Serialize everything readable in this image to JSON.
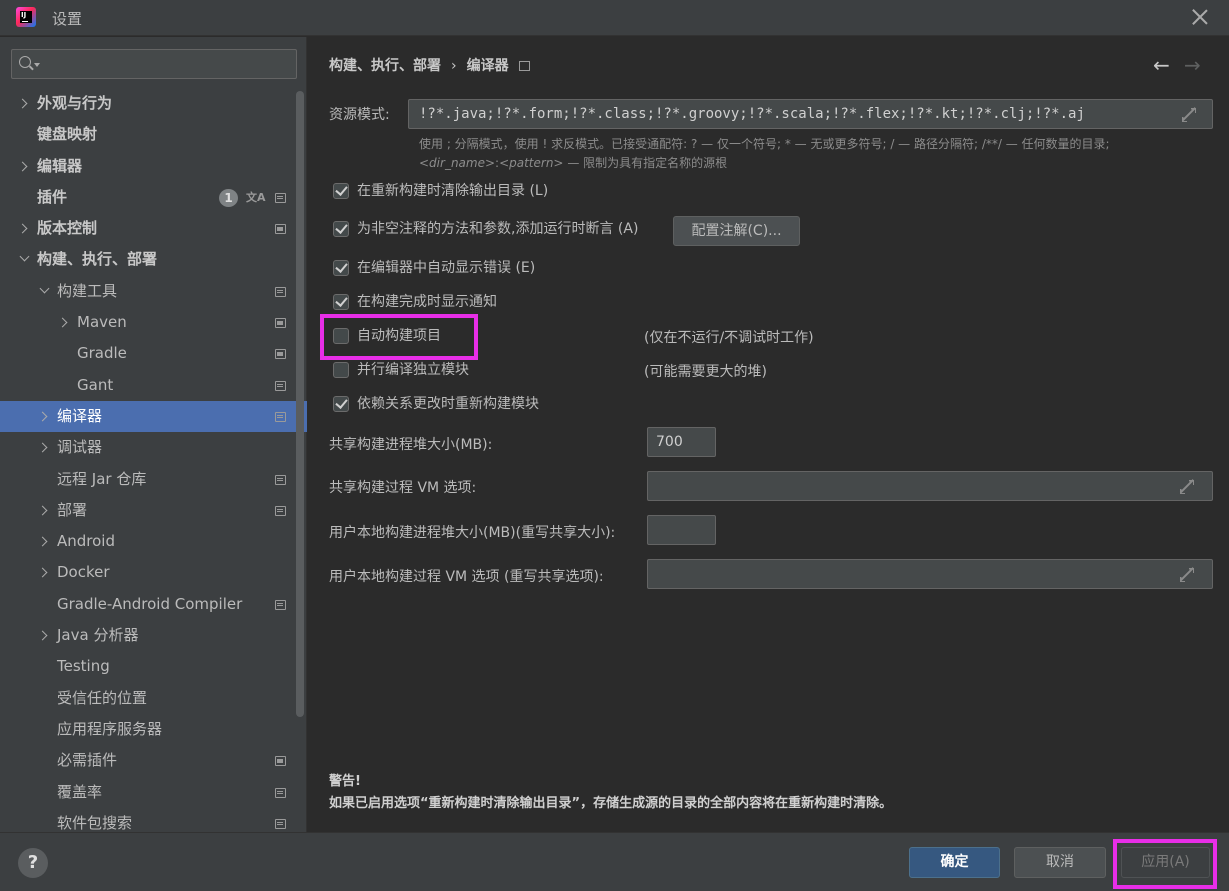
{
  "window": {
    "title": "设置"
  },
  "sidebar": {
    "search_placeholder": "",
    "items": [
      {
        "label": "外观与行为",
        "level": 0,
        "expander": "collapsed",
        "bold": true,
        "icons": []
      },
      {
        "label": "键盘映射",
        "level": 0,
        "expander": "none",
        "bold": true,
        "icons": []
      },
      {
        "label": "编辑器",
        "level": 0,
        "expander": "collapsed",
        "bold": true,
        "icons": []
      },
      {
        "label": "插件",
        "level": 0,
        "expander": "none",
        "bold": true,
        "icons": [
          "badge",
          "translate",
          "project"
        ],
        "badge": "1"
      },
      {
        "label": "版本控制",
        "level": 0,
        "expander": "collapsed",
        "bold": true,
        "icons": [
          "project"
        ]
      },
      {
        "label": "构建、执行、部署",
        "level": 0,
        "expander": "expanded",
        "bold": true,
        "icons": []
      },
      {
        "label": "构建工具",
        "level": 1,
        "expander": "expanded",
        "bold": false,
        "icons": [
          "project"
        ]
      },
      {
        "label": "Maven",
        "level": 2,
        "expander": "collapsed",
        "bold": false,
        "icons": [
          "project"
        ]
      },
      {
        "label": "Gradle",
        "level": 2,
        "expander": "none",
        "bold": false,
        "icons": [
          "project"
        ]
      },
      {
        "label": "Gant",
        "level": 2,
        "expander": "none",
        "bold": false,
        "icons": [
          "project"
        ]
      },
      {
        "label": "编译器",
        "level": 1,
        "expander": "collapsed",
        "bold": false,
        "icons": [
          "project"
        ],
        "selected": true
      },
      {
        "label": "调试器",
        "level": 1,
        "expander": "collapsed",
        "bold": false,
        "icons": []
      },
      {
        "label": "远程 Jar 仓库",
        "level": 1,
        "expander": "none",
        "bold": false,
        "icons": [
          "project"
        ]
      },
      {
        "label": "部署",
        "level": 1,
        "expander": "collapsed",
        "bold": false,
        "icons": [
          "project"
        ]
      },
      {
        "label": "Android",
        "level": 1,
        "expander": "collapsed",
        "bold": false,
        "icons": []
      },
      {
        "label": "Docker",
        "level": 1,
        "expander": "collapsed",
        "bold": false,
        "icons": []
      },
      {
        "label": "Gradle-Android Compiler",
        "level": 1,
        "expander": "none",
        "bold": false,
        "icons": [
          "project"
        ]
      },
      {
        "label": "Java 分析器",
        "level": 1,
        "expander": "collapsed",
        "bold": false,
        "icons": []
      },
      {
        "label": "Testing",
        "level": 1,
        "expander": "none",
        "bold": false,
        "icons": []
      },
      {
        "label": "受信任的位置",
        "level": 1,
        "expander": "none",
        "bold": false,
        "icons": []
      },
      {
        "label": "应用程序服务器",
        "level": 1,
        "expander": "none",
        "bold": false,
        "icons": []
      },
      {
        "label": "必需插件",
        "level": 1,
        "expander": "none",
        "bold": false,
        "icons": [
          "project"
        ]
      },
      {
        "label": "覆盖率",
        "level": 1,
        "expander": "none",
        "bold": false,
        "icons": [
          "project"
        ]
      },
      {
        "label": "软件包搜索",
        "level": 1,
        "expander": "none",
        "bold": false,
        "icons": [
          "project"
        ]
      }
    ]
  },
  "main": {
    "breadcrumb": [
      "构建、执行、部署",
      "编译器"
    ],
    "resource_patterns": {
      "label": "资源模式:",
      "value": "!?*.java;!?*.form;!?*.class;!?*.groovy;!?*.scala;!?*.flex;!?*.kt;!?*.clj;!?*.aj",
      "hint_line1": "使用 ; 分隔模式，使用 ! 求反模式。已接受通配符: ? — 仅一个符号; * — 无或更多符号; / — 路径分隔符; /**/ — 任何数量的目录;",
      "hint_line2_em1": "<dir_name>",
      "hint_line2_sep": ":",
      "hint_line2_em2": "<pattern>",
      "hint_line2_rest": " — 限制为具有指定名称的源根"
    },
    "checkboxes": [
      {
        "label": "在重新构建时清除输出目录 (L)",
        "checked": true
      },
      {
        "label": "为非空注释的方法和参数,添加运行时断言 (A)",
        "checked": true
      },
      {
        "label": "在编辑器中自动显示错误 (E)",
        "checked": true
      },
      {
        "label": "在构建完成时显示通知",
        "checked": true
      },
      {
        "label": "自动构建项目",
        "checked": false
      },
      {
        "label": "并行编译独立模块",
        "checked": false
      },
      {
        "label": "依赖关系更改时重新构建模块",
        "checked": true
      }
    ],
    "configure_annotations_button": "配置注解(C)...",
    "notes": {
      "auto_build": "(仅在不运行/不调试时工作)",
      "parallel": "(可能需要更大的堆)"
    },
    "fields": {
      "shared_heap_label": "共享构建进程堆大小(MB):",
      "shared_heap_value": "700",
      "shared_vm_label": "共享构建过程 VM 选项:",
      "shared_vm_value": "",
      "user_heap_label": "用户本地构建进程堆大小(MB)(重写共享大小):",
      "user_heap_value": "",
      "user_vm_label": "用户本地构建过程 VM 选项 (重写共享选项):",
      "user_vm_value": ""
    },
    "warning": {
      "title": "警告!",
      "text": "如果已启用选项“重新构建时清除输出目录”，存储生成源的目录的全部内容将在重新构建时清除。"
    }
  },
  "footer": {
    "help": "?",
    "ok": "确定",
    "cancel": "取消",
    "apply": "应用(A)"
  },
  "colors": {
    "selection": "#4b6eaf",
    "highlight": "#e82ee8",
    "ok_button": "#365880"
  }
}
